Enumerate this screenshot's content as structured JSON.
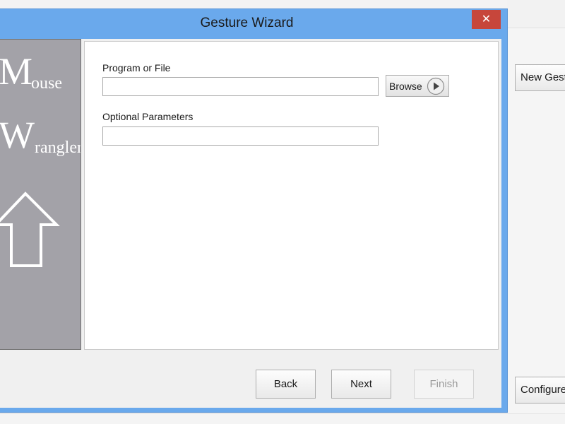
{
  "dialog": {
    "title": "Gesture Wizard",
    "close_icon": "close-icon",
    "close_glyph": "✕"
  },
  "banner": {
    "line1_initial": "M",
    "line1_rest": "ouse",
    "line2_initial": "W",
    "line2_rest": "rangler",
    "icon": "up-arrow-icon"
  },
  "form": {
    "program_label": "Program or File",
    "program_value": "",
    "params_label": "Optional Parameters",
    "params_value": "",
    "browse_label": "Browse",
    "browse_icon": "play-icon"
  },
  "buttons": {
    "back": "Back",
    "next": "Next",
    "finish": "Finish"
  },
  "background_window": {
    "new_gesture_label": "New Gesture",
    "configure_label": "Configure"
  },
  "colors": {
    "title_bar": "#6aa9ec",
    "close_button": "#c7463b",
    "banner": "#a3a2a8"
  }
}
